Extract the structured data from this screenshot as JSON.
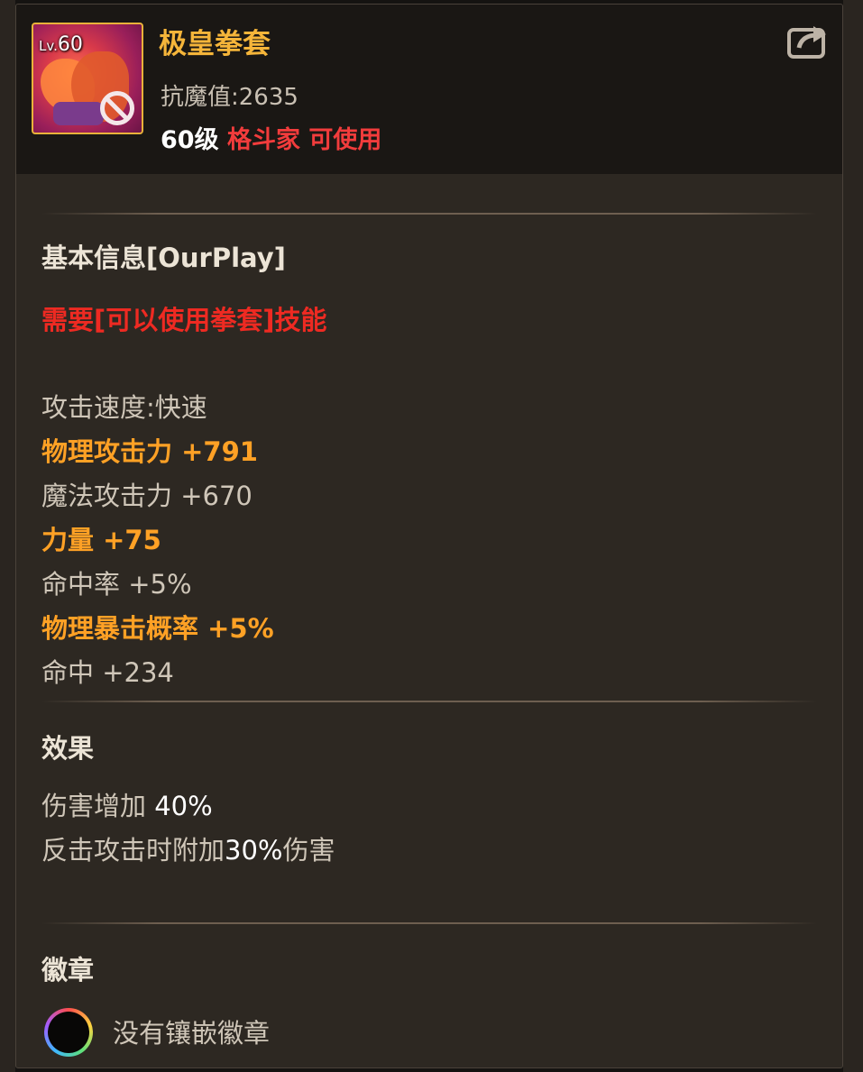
{
  "item": {
    "name": "极皇拳套",
    "level_badge_prefix": "Lv.",
    "level_badge_value": "60",
    "magic_resist": "抗魔值:2635",
    "req_level": "60级",
    "req_class": "格斗家 可使用"
  },
  "icons": {
    "share": "share-icon",
    "item": "fist-glove-icon",
    "forbid": "forbidden-icon",
    "badge_slot": "empty-badge-slot-icon"
  },
  "basic": {
    "title": "基本信息[OurPlay]",
    "requirement": "需要[可以使用拳套]技能",
    "stats": [
      {
        "text": "攻击速度:快速",
        "style": "grey"
      },
      {
        "text": "物理攻击力 +791",
        "style": "orange"
      },
      {
        "text": "魔法攻击力 +670",
        "style": "grey"
      },
      {
        "text": "力量 +75",
        "style": "orange"
      },
      {
        "text": "命中率 +5%",
        "style": "grey"
      },
      {
        "text": "物理暴击概率 +5%",
        "style": "orange"
      },
      {
        "text": "命中 +234",
        "style": "grey"
      }
    ]
  },
  "effect": {
    "title": "效果",
    "line1_text": "伤害增加 ",
    "line1_value": "40%",
    "line2_text_a": "反击攻击时附加",
    "line2_value": "30%",
    "line2_text_b": "伤害"
  },
  "badge": {
    "title": "徽章",
    "empty_text": "没有镶嵌徽章"
  },
  "colors": {
    "name": "#f5b53a",
    "orange_stat": "#ffa125",
    "red": "#ee2a22",
    "grey": "#cfc6b8"
  }
}
